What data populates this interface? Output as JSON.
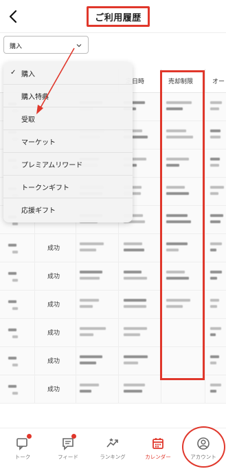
{
  "header": {
    "title": "ご利用履歴",
    "back_icon": "chevron-left-icon"
  },
  "filter": {
    "selected": "購入",
    "icon": "chevron-down-icon"
  },
  "table": {
    "columns": [
      "定日時",
      "売却制限",
      "オー"
    ],
    "rows": [
      {
        "status": ""
      },
      {
        "status": ""
      },
      {
        "status": ""
      },
      {
        "status": ""
      },
      {
        "status": ""
      },
      {
        "status": "成功"
      },
      {
        "status": "成功"
      },
      {
        "status": "成功"
      },
      {
        "status": "成功"
      },
      {
        "status": "成功"
      },
      {
        "status": "成功"
      }
    ]
  },
  "dropdown": {
    "items": [
      "購入",
      "購入特典",
      "受取",
      "マーケット",
      "プレミアムリワード",
      "トークンギフト",
      "応援ギフト"
    ],
    "checked_index": 0
  },
  "tabbar": {
    "items": [
      {
        "label": "トーク",
        "icon": "chat-icon",
        "badge": true
      },
      {
        "label": "フィード",
        "icon": "feed-icon",
        "badge": true
      },
      {
        "label": "ランキング",
        "icon": "ranking-icon",
        "badge": false
      },
      {
        "label": "カレンダー",
        "icon": "calendar-icon",
        "badge": false,
        "active": true
      },
      {
        "label": "アカウント",
        "icon": "account-icon",
        "badge": false
      }
    ]
  },
  "colors": {
    "accent": "#e0372b"
  }
}
